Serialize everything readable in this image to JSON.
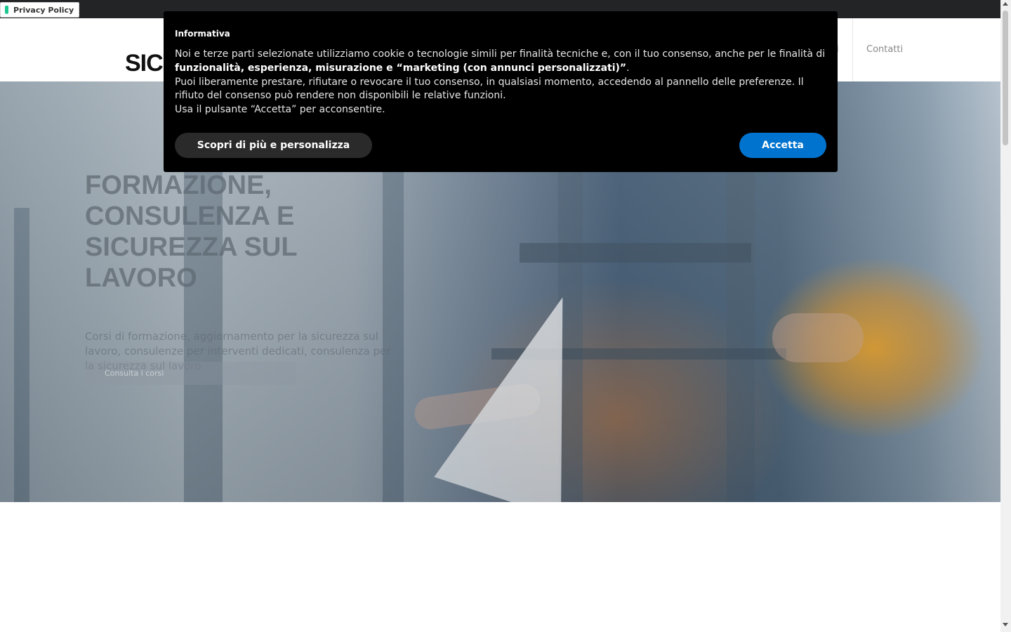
{
  "privacy_badge": {
    "label": "Privacy Policy"
  },
  "header": {
    "logo_text": "SICU",
    "nav_partial": "ti",
    "nav_contact": "Contatti"
  },
  "hero": {
    "title": "FORMAZIONE, CONSULENZA E SICUREZZA SUL LAVORO",
    "text": "Corsi di formazione, aggiornamento per la sicurezza sul lavoro, consulenze per interventi dedicati, consulenza per la sicurezza sul lavoro",
    "button_label": "Consulta i corsi"
  },
  "cookie_banner": {
    "title": "Informativa",
    "text_part1": "Noi e terze parti selezionate utilizziamo cookie o tecnologie simili per finalità tecniche e, con il tuo consenso, anche per le finalità di ",
    "text_bold": "funzionalità, esperienza, misurazione e “marketing (con annunci personalizzati)”",
    "text_part2": ".",
    "text_line2": "Puoi liberamente prestare, rifiutare o revocare il tuo consenso, in qualsiasi momento, accedendo al pannello delle preferenze. Il rifiuto del consenso può rendere non disponibili le relative funzioni.",
    "text_line3": "Usa il pulsante “Accetta” per acconsentire.",
    "learn_more_label": "Scopri di più e personalizza",
    "accept_label": "Accetta"
  },
  "colors": {
    "accept_button": "#0073ce",
    "privacy_shield": "#1cc691",
    "banner_background": "#000000"
  }
}
